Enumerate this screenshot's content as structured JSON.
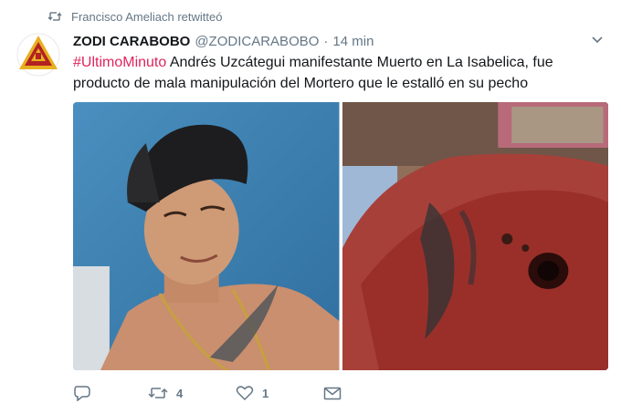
{
  "retweet_context": {
    "text": "Francisco Ameliach retwitteó",
    "icon": "retweet-icon"
  },
  "tweet": {
    "display_name": "ZODI CARABOBO",
    "handle": "@ZODICARABOBO",
    "separator": "·",
    "time": "14 min",
    "hashtag": "#UltimoMinuto",
    "body": " Andrés Uzcátegui manifestante Muerto en La Isabelica, fue producto de mala manipulación del Mortero que le estalló en su pecho",
    "media_count": 2
  },
  "actions": {
    "reply_icon": "reply-icon",
    "retweet_icon": "retweet-icon",
    "retweet_count": "4",
    "like_icon": "heart-icon",
    "like_count": "1",
    "dm_icon": "envelope-icon"
  },
  "colors": {
    "text": "#14171a",
    "secondary": "#657786",
    "hashtag": "#e0245e",
    "avatar_red": "#b22222",
    "avatar_gold": "#e8b020"
  }
}
